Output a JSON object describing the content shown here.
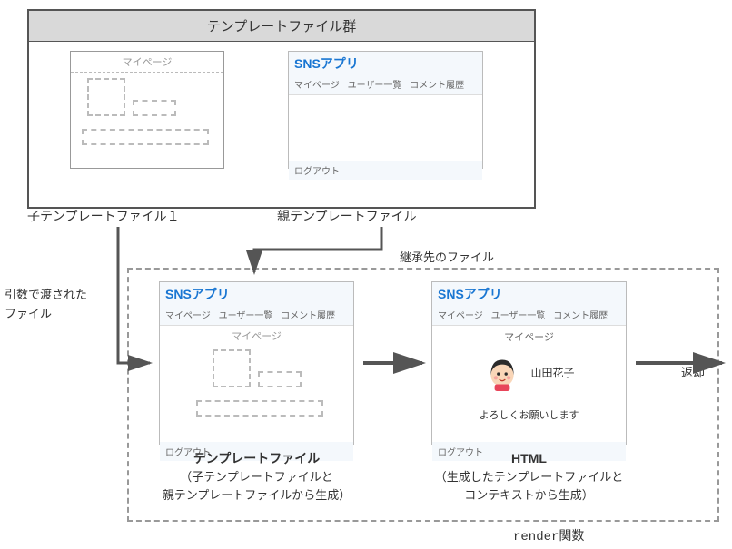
{
  "outer": {
    "title": "テンプレートファイル群"
  },
  "child": {
    "header": "マイページ",
    "caption": "子テンプレートファイル１"
  },
  "parent": {
    "title": "SNSアプリ",
    "nav1": "マイページ",
    "nav2": "ユーザー一覧",
    "nav3": "コメント履歴",
    "footer": "ログアウト",
    "caption": "親テンプレートファイル"
  },
  "labels": {
    "inherit": "継承先のファイル",
    "arg_l1": "引数で渡された",
    "arg_l2": "ファイル",
    "return": "返却",
    "render": "render関数"
  },
  "combined": {
    "title": "SNSアプリ",
    "nav1": "マイページ",
    "nav2": "ユーザー一覧",
    "nav3": "コメント履歴",
    "body_header": "マイページ",
    "footer": "ログアウト",
    "caption_bold": "テンプレートファイル",
    "caption_sub1": "（子テンプレートファイルと",
    "caption_sub2": "親テンプレートファイルから生成）"
  },
  "html_out": {
    "title": "SNSアプリ",
    "nav1": "マイページ",
    "nav2": "ユーザー一覧",
    "nav3": "コメント履歴",
    "body_header": "マイページ",
    "username": "山田花子",
    "greeting": "よろしくお願いします",
    "footer": "ログアウト",
    "caption_bold": "HTML",
    "caption_sub1": "（生成したテンプレートファイルと",
    "caption_sub2": "コンテキストから生成）"
  }
}
